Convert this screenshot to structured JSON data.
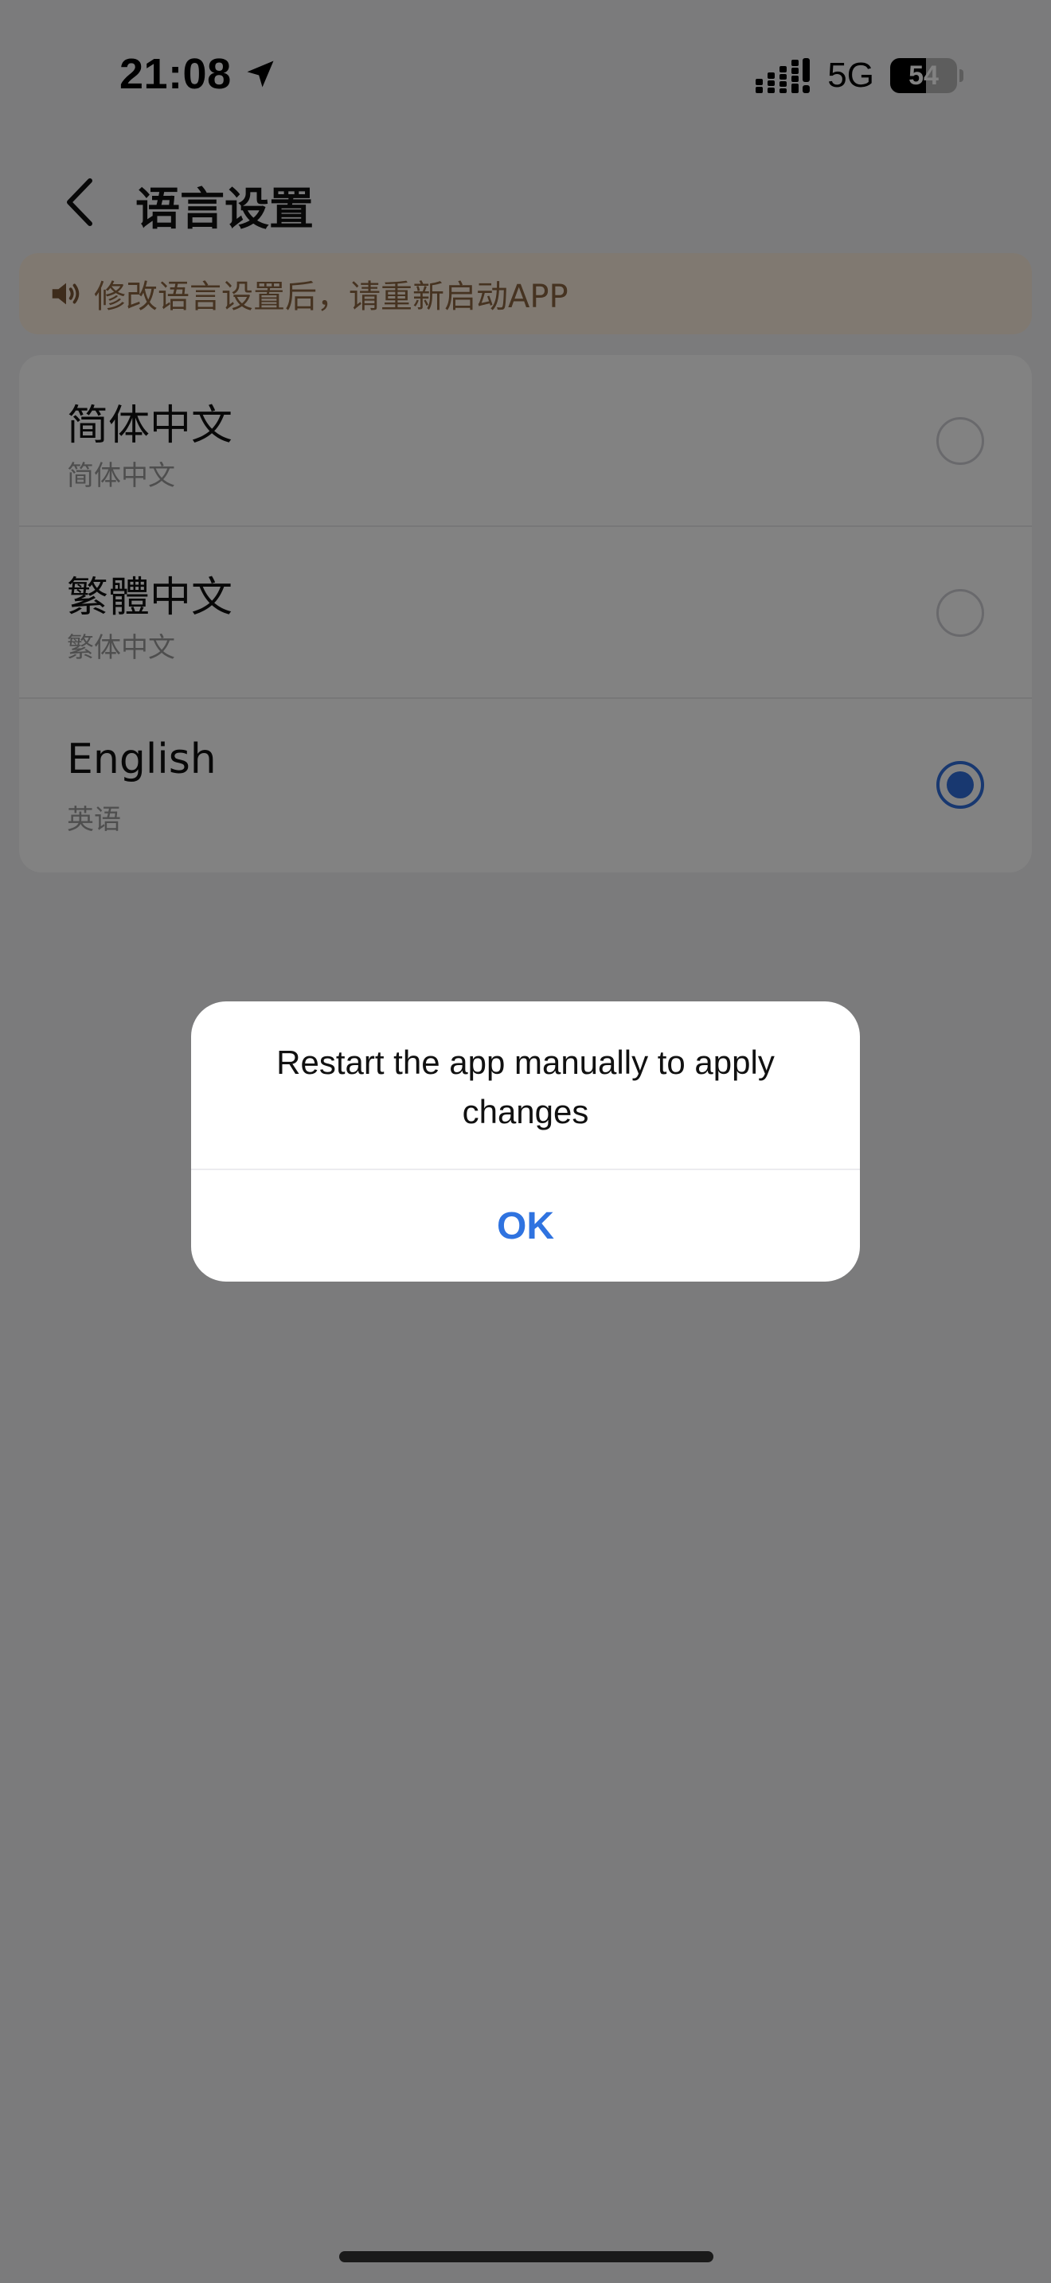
{
  "status_bar": {
    "time": "21:08",
    "network": "5G",
    "battery_level": "54",
    "icons": [
      "location-arrow-icon",
      "cellular-signal-icon",
      "battery-icon"
    ]
  },
  "header": {
    "title": "语言设置",
    "back_icon": "chevron-left-icon"
  },
  "notice": {
    "icon": "speaker-icon",
    "text": "修改语言设置后，请重新启动APP"
  },
  "languages": [
    {
      "name": "简体中文",
      "subtitle": "简体中文",
      "selected": false
    },
    {
      "name": "繁體中文",
      "subtitle": "繁体中文",
      "selected": false
    },
    {
      "name": "English",
      "subtitle": "英语",
      "selected": true
    }
  ],
  "dialog": {
    "message": "Restart the app manually to apply changes",
    "ok_label": "OK"
  },
  "colors": {
    "accent": "#2f6fdb",
    "notice_bg": "#fbeedd",
    "notice_text": "#8a6441"
  }
}
